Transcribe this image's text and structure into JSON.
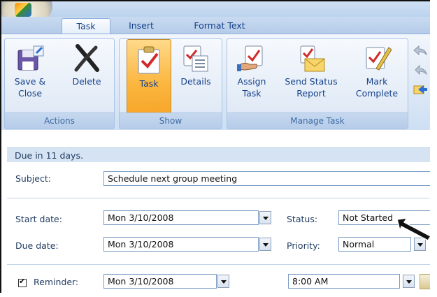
{
  "ribbon": {
    "tabs": [
      "Task",
      "Insert",
      "Format Text"
    ],
    "groups": {
      "actions": {
        "label": "Actions",
        "save_close": "Save &\nClose",
        "delete": "Delete"
      },
      "show": {
        "label": "Show",
        "task": "Task",
        "details": "Details"
      },
      "manage": {
        "label": "Manage Task",
        "assign": "Assign\nTask",
        "send_status": "Send Status\nReport",
        "mark_complete": "Mark\nComplete"
      }
    }
  },
  "info_bar": "Due in 11 days.",
  "form": {
    "subject_label": "Subject:",
    "subject_value": "Schedule next group meeting",
    "start_date_label": "Start date:",
    "start_date_value": "Mon 3/10/2008",
    "due_date_label": "Due date:",
    "due_date_value": "Mon 3/10/2008",
    "status_label": "Status:",
    "status_value": "Not Started",
    "priority_label": "Priority:",
    "priority_value": "Normal",
    "reminder_label": "Reminder:",
    "reminder_checked": true,
    "reminder_date": "Mon 3/10/2008",
    "reminder_time": "8:00 AM"
  },
  "colors": {
    "ribbon_text": "#15428b",
    "pressed_button": "#fbb63f",
    "info_bar": "#d5e3f3"
  }
}
